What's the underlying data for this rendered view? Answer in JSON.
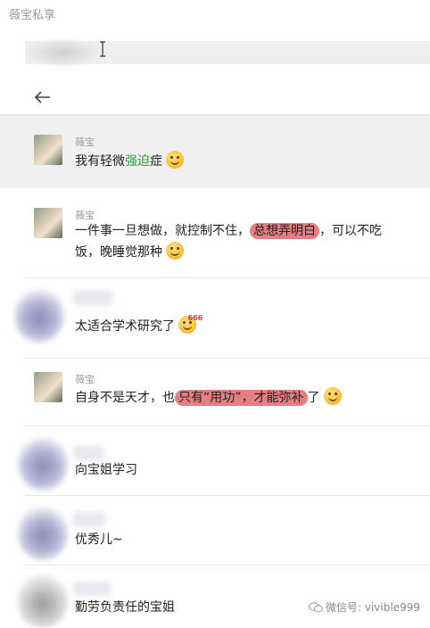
{
  "app_title": "薇宝私享",
  "comments": [
    {
      "username": "薇宝",
      "text_a": "我有轻微",
      "text_green": "强迫",
      "text_b": "症",
      "emoji": "face-with-tears-of-joy-lying"
    },
    {
      "username": "薇宝",
      "line1_a": "一件事一旦想做，就控制不住，",
      "line1_red": "总想弄明白",
      "line1_b": "，可以不吃",
      "line2": "饭，晚睡觉那种",
      "emoji": "grinning-squint-face"
    },
    {
      "text": "太适合学术研究了",
      "emoji": "nerd-face",
      "emoji_tag": "666"
    },
    {
      "username": "薇宝",
      "text_a": "自身不是天才，也",
      "text_red": "只有“用功”，才能弥补",
      "text_b": "了",
      "emoji": "persevering-face"
    },
    {
      "text": "向宝姐学习"
    },
    {
      "text": "优秀儿~"
    },
    {
      "text": "勤劳负责任的宝姐"
    }
  ],
  "watermark": "微信号: vivible999",
  "colors": {
    "green_highlight": "#2ea043",
    "red_highlight": "#e77e82",
    "selected_row": "#f0f0f0"
  }
}
